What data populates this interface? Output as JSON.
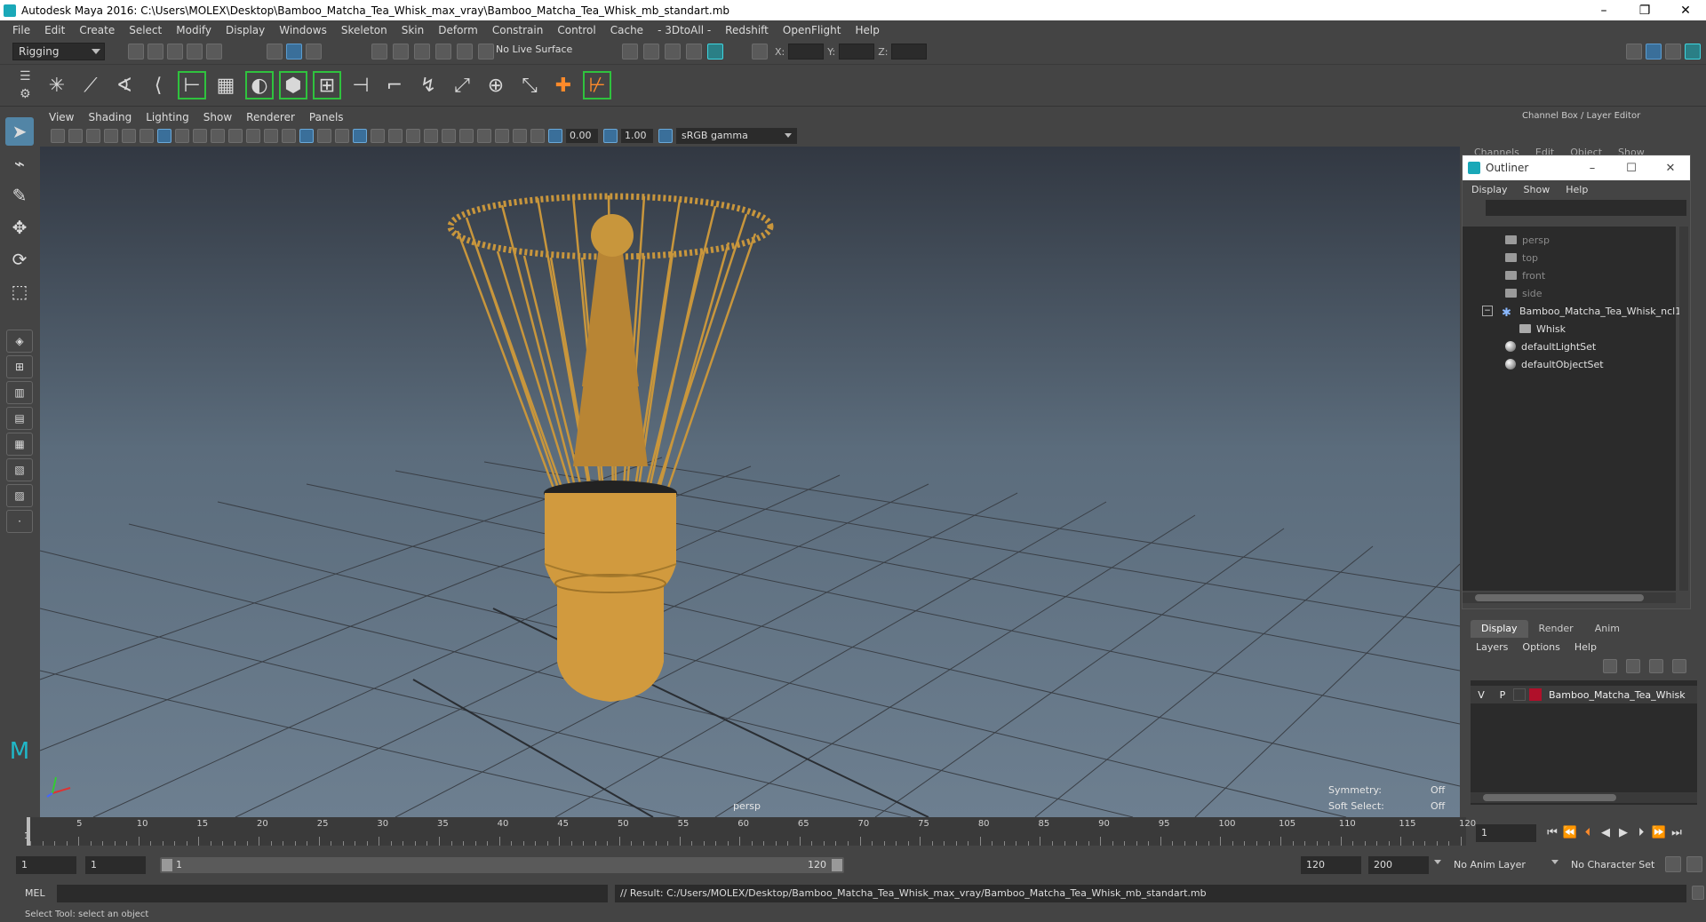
{
  "window": {
    "title": "Autodesk Maya 2016: C:\\Users\\MOLEX\\Desktop\\Bamboo_Matcha_Tea_Whisk_max_vray\\Bamboo_Matcha_Tea_Whisk_mb_standart.mb",
    "minimize": "–",
    "restore": "❐",
    "close": "✕"
  },
  "menubar": [
    "File",
    "Edit",
    "Create",
    "Select",
    "Modify",
    "Display",
    "Windows",
    "Skeleton",
    "Skin",
    "Deform",
    "Constrain",
    "Control",
    "Cache",
    "- 3DtoAll -",
    "Redshift",
    "OpenFlight",
    "Help"
  ],
  "statusline": {
    "mode": "Rigging",
    "live_surface": "No Live Surface",
    "x_label": "X:",
    "y_label": "Y:",
    "z_label": "Z:"
  },
  "viewport": {
    "menu": [
      "View",
      "Shading",
      "Lighting",
      "Show",
      "Renderer",
      "Panels"
    ],
    "exposure": "0.00",
    "gamma": "1.00",
    "color_space": "sRGB gamma",
    "camera_label": "persp",
    "symmetry_label": "Symmetry:",
    "symmetry_value": "Off",
    "soft_select_label": "Soft Select:",
    "soft_select_value": "Off"
  },
  "channel_box": {
    "title": "Channel Box / Layer Editor",
    "menu": [
      "Channels",
      "Edit",
      "Object",
      "Show"
    ]
  },
  "outliner": {
    "title": "Outliner",
    "menu": [
      "Display",
      "Show",
      "Help"
    ],
    "items": [
      {
        "label": "persp",
        "type": "camera",
        "dim": true
      },
      {
        "label": "top",
        "type": "camera",
        "dim": true
      },
      {
        "label": "front",
        "type": "camera",
        "dim": true
      },
      {
        "label": "side",
        "type": "camera",
        "dim": true
      },
      {
        "label": "Bamboo_Matcha_Tea_Whisk_ncl1_",
        "type": "group",
        "dim": false
      },
      {
        "label": "Whisk",
        "type": "mesh",
        "dim": false
      },
      {
        "label": "defaultLightSet",
        "type": "set",
        "dim": false
      },
      {
        "label": "defaultObjectSet",
        "type": "set",
        "dim": false
      }
    ]
  },
  "layer_editor": {
    "tabs": [
      "Display",
      "Render",
      "Anim"
    ],
    "active_tab": "Display",
    "menu": [
      "Layers",
      "Options",
      "Help"
    ],
    "layer": {
      "visible": "V",
      "playback": "P",
      "name": "Bamboo_Matcha_Tea_Whisk",
      "color": "#b0102a"
    }
  },
  "timeline": {
    "start_marker": "1",
    "ticks": [
      "5",
      "10",
      "15",
      "20",
      "25",
      "30",
      "35",
      "40",
      "45",
      "50",
      "55",
      "60",
      "65",
      "70",
      "75",
      "80",
      "85",
      "90",
      "95",
      "100",
      "105",
      "110",
      "115",
      "120"
    ],
    "current_frame": "1"
  },
  "range": {
    "start": "1",
    "playback_start": "1",
    "slider_start": "1",
    "slider_end": "120",
    "playback_end": "120",
    "end": "200",
    "anim_layer": "No Anim Layer",
    "character_set": "No Character Set"
  },
  "command_line": {
    "lang": "MEL",
    "result": "// Result: C:/Users/MOLEX/Desktop/Bamboo_Matcha_Tea_Whisk_max_vray/Bamboo_Matcha_Tea_Whisk_mb_standart.mb"
  },
  "help_line": "Select Tool: select an object",
  "colors": {
    "ui_bg": "#444444",
    "field_bg": "#2b2b2b",
    "accent_blue": "#5285a6",
    "whisk": "#c8963c",
    "layer_color": "#b0102a"
  }
}
